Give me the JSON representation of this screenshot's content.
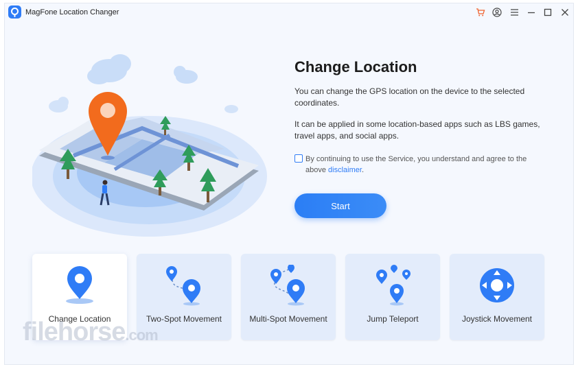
{
  "app": {
    "title": "MagFone Location Changer"
  },
  "titlebar": {
    "icons": [
      "cart-icon",
      "account-icon",
      "menu-icon",
      "minimize-icon",
      "maximize-icon",
      "close-icon"
    ]
  },
  "main": {
    "heading": "Change Location",
    "desc1": "You can change the GPS location on the device to the selected coordinates.",
    "desc2": "It can be applied in some location-based apps such as LBS games, travel apps, and social apps.",
    "agree_text": "By continuing to use the Service, you understand and agree to the above ",
    "disclaimer": "disclaimer",
    "agree_end": ".",
    "agree_checked": false,
    "start_label": "Start"
  },
  "modes": [
    {
      "label": "Change Location",
      "icon": "location-pin-icon",
      "active": true
    },
    {
      "label": "Two-Spot Movement",
      "icon": "two-spot-icon",
      "active": false
    },
    {
      "label": "Multi-Spot Movement",
      "icon": "multi-spot-icon",
      "active": false
    },
    {
      "label": "Jump Teleport",
      "icon": "jump-teleport-icon",
      "active": false
    },
    {
      "label": "Joystick Movement",
      "icon": "joystick-icon",
      "active": false
    }
  ],
  "watermark": {
    "text": "filehorse",
    "suffix": ".com"
  },
  "colors": {
    "accent": "#2f7cf6",
    "background": "#f5f8fe",
    "card": "#e3ecfb"
  }
}
